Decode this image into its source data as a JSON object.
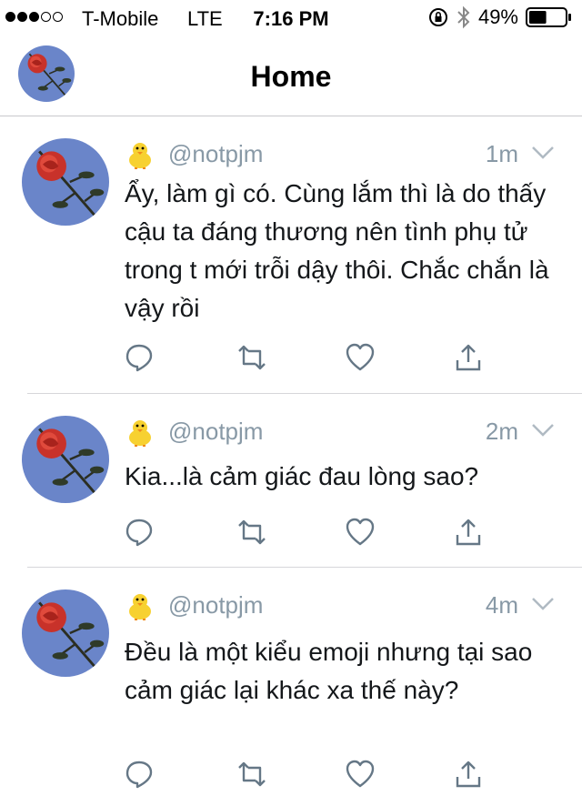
{
  "status_bar": {
    "signal_bars_full": 3,
    "signal_bars_total": 5,
    "carrier": "T-Mobile",
    "network": "LTE",
    "time": "7:16 PM",
    "battery": "49%",
    "battery_level": 0.49,
    "icons": [
      "orientation-lock-icon",
      "bluetooth-icon",
      "battery-icon"
    ]
  },
  "nav": {
    "title": "Home"
  },
  "colors": {
    "avatar_bg": "#6a85c9",
    "meta_gray": "#8899a6",
    "icon_color": "#657786",
    "text": "#14171a"
  },
  "tweets": [
    {
      "handle": "@notpjm",
      "time": "1m",
      "text": "Ẩy, làm gì có. Cùng lắm thì là do thấy cậu ta đáng thương nên tình phụ tử trong t mới trỗi dậy thôi. Chắc chắn là vậy rồi"
    },
    {
      "handle": "@notpjm",
      "time": "2m",
      "text": "Kia...là cảm giác đau lòng sao?"
    },
    {
      "handle": "@notpjm",
      "time": "4m",
      "text": "Đều là một kiểu emoji nhưng tại sao cảm giác lại khác xa thế này?"
    }
  ]
}
